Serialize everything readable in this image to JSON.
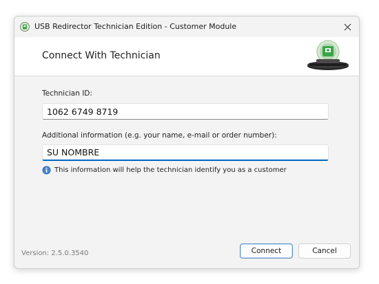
{
  "window": {
    "title": "USB Redirector Technician Edition - Customer Module",
    "close_icon": "close-icon"
  },
  "header": {
    "title": "Connect With Technician",
    "logo_icon": "usb-redirector-logo"
  },
  "form": {
    "technician_id_label": "Technician ID:",
    "technician_id_value": "1062 6749 8719",
    "additional_info_label": "Additional information (e.g. your name, e-mail or order number):",
    "additional_info_value": "SU NOMBRE",
    "hint_icon": "info-icon",
    "hint_text": "This information will help the technician identify you as a customer"
  },
  "footer": {
    "version": "Version: 2.5.0.3540",
    "connect_label": "Connect",
    "cancel_label": "Cancel"
  },
  "colors": {
    "accent": "#0067c0",
    "info_blue": "#2e6db4",
    "logo_green": "#3aa64a"
  }
}
